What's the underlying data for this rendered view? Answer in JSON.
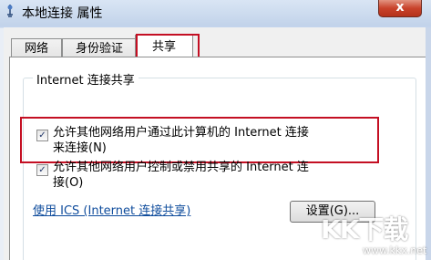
{
  "window": {
    "title": "本地连接 属性",
    "close_label": "x"
  },
  "tabs": [
    {
      "label": "网络"
    },
    {
      "label": "身份验证"
    },
    {
      "label": "共享"
    }
  ],
  "group": {
    "legend": "Internet 连接共享",
    "option1_line1": "允许其他网络用户通过此计算机的 Internet 连接",
    "option1_line2": "来连接(N)",
    "option1_checked": "✓",
    "option2_line1": "允许其他网络用户控制或禁用共享的 Internet 连",
    "option2_line2": "接(O)",
    "option2_checked": "✓"
  },
  "ics_link": "使用 ICS (Internet 连接共享)",
  "settings_button": "设置(G)...",
  "watermark": {
    "text": "KK下载",
    "url": "www.kkx.net"
  }
}
